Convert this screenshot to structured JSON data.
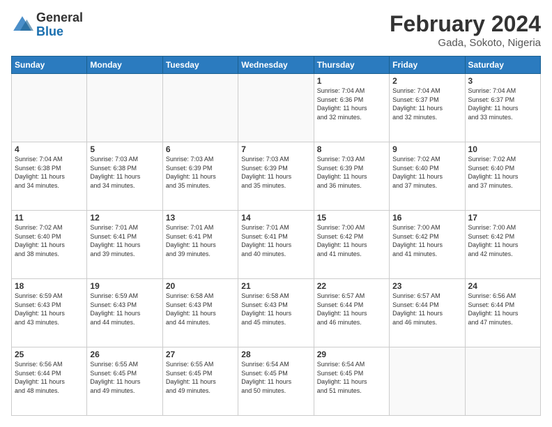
{
  "header": {
    "logo_line1": "General",
    "logo_line2": "Blue",
    "month_year": "February 2024",
    "location": "Gada, Sokoto, Nigeria"
  },
  "weekdays": [
    "Sunday",
    "Monday",
    "Tuesday",
    "Wednesday",
    "Thursday",
    "Friday",
    "Saturday"
  ],
  "weeks": [
    [
      {
        "date": "",
        "info": ""
      },
      {
        "date": "",
        "info": ""
      },
      {
        "date": "",
        "info": ""
      },
      {
        "date": "",
        "info": ""
      },
      {
        "date": "1",
        "info": "Sunrise: 7:04 AM\nSunset: 6:36 PM\nDaylight: 11 hours\nand 32 minutes."
      },
      {
        "date": "2",
        "info": "Sunrise: 7:04 AM\nSunset: 6:37 PM\nDaylight: 11 hours\nand 32 minutes."
      },
      {
        "date": "3",
        "info": "Sunrise: 7:04 AM\nSunset: 6:37 PM\nDaylight: 11 hours\nand 33 minutes."
      }
    ],
    [
      {
        "date": "4",
        "info": "Sunrise: 7:04 AM\nSunset: 6:38 PM\nDaylight: 11 hours\nand 34 minutes."
      },
      {
        "date": "5",
        "info": "Sunrise: 7:03 AM\nSunset: 6:38 PM\nDaylight: 11 hours\nand 34 minutes."
      },
      {
        "date": "6",
        "info": "Sunrise: 7:03 AM\nSunset: 6:39 PM\nDaylight: 11 hours\nand 35 minutes."
      },
      {
        "date": "7",
        "info": "Sunrise: 7:03 AM\nSunset: 6:39 PM\nDaylight: 11 hours\nand 35 minutes."
      },
      {
        "date": "8",
        "info": "Sunrise: 7:03 AM\nSunset: 6:39 PM\nDaylight: 11 hours\nand 36 minutes."
      },
      {
        "date": "9",
        "info": "Sunrise: 7:02 AM\nSunset: 6:40 PM\nDaylight: 11 hours\nand 37 minutes."
      },
      {
        "date": "10",
        "info": "Sunrise: 7:02 AM\nSunset: 6:40 PM\nDaylight: 11 hours\nand 37 minutes."
      }
    ],
    [
      {
        "date": "11",
        "info": "Sunrise: 7:02 AM\nSunset: 6:40 PM\nDaylight: 11 hours\nand 38 minutes."
      },
      {
        "date": "12",
        "info": "Sunrise: 7:01 AM\nSunset: 6:41 PM\nDaylight: 11 hours\nand 39 minutes."
      },
      {
        "date": "13",
        "info": "Sunrise: 7:01 AM\nSunset: 6:41 PM\nDaylight: 11 hours\nand 39 minutes."
      },
      {
        "date": "14",
        "info": "Sunrise: 7:01 AM\nSunset: 6:41 PM\nDaylight: 11 hours\nand 40 minutes."
      },
      {
        "date": "15",
        "info": "Sunrise: 7:00 AM\nSunset: 6:42 PM\nDaylight: 11 hours\nand 41 minutes."
      },
      {
        "date": "16",
        "info": "Sunrise: 7:00 AM\nSunset: 6:42 PM\nDaylight: 11 hours\nand 41 minutes."
      },
      {
        "date": "17",
        "info": "Sunrise: 7:00 AM\nSunset: 6:42 PM\nDaylight: 11 hours\nand 42 minutes."
      }
    ],
    [
      {
        "date": "18",
        "info": "Sunrise: 6:59 AM\nSunset: 6:43 PM\nDaylight: 11 hours\nand 43 minutes."
      },
      {
        "date": "19",
        "info": "Sunrise: 6:59 AM\nSunset: 6:43 PM\nDaylight: 11 hours\nand 44 minutes."
      },
      {
        "date": "20",
        "info": "Sunrise: 6:58 AM\nSunset: 6:43 PM\nDaylight: 11 hours\nand 44 minutes."
      },
      {
        "date": "21",
        "info": "Sunrise: 6:58 AM\nSunset: 6:43 PM\nDaylight: 11 hours\nand 45 minutes."
      },
      {
        "date": "22",
        "info": "Sunrise: 6:57 AM\nSunset: 6:44 PM\nDaylight: 11 hours\nand 46 minutes."
      },
      {
        "date": "23",
        "info": "Sunrise: 6:57 AM\nSunset: 6:44 PM\nDaylight: 11 hours\nand 46 minutes."
      },
      {
        "date": "24",
        "info": "Sunrise: 6:56 AM\nSunset: 6:44 PM\nDaylight: 11 hours\nand 47 minutes."
      }
    ],
    [
      {
        "date": "25",
        "info": "Sunrise: 6:56 AM\nSunset: 6:44 PM\nDaylight: 11 hours\nand 48 minutes."
      },
      {
        "date": "26",
        "info": "Sunrise: 6:55 AM\nSunset: 6:45 PM\nDaylight: 11 hours\nand 49 minutes."
      },
      {
        "date": "27",
        "info": "Sunrise: 6:55 AM\nSunset: 6:45 PM\nDaylight: 11 hours\nand 49 minutes."
      },
      {
        "date": "28",
        "info": "Sunrise: 6:54 AM\nSunset: 6:45 PM\nDaylight: 11 hours\nand 50 minutes."
      },
      {
        "date": "29",
        "info": "Sunrise: 6:54 AM\nSunset: 6:45 PM\nDaylight: 11 hours\nand 51 minutes."
      },
      {
        "date": "",
        "info": ""
      },
      {
        "date": "",
        "info": ""
      }
    ]
  ]
}
